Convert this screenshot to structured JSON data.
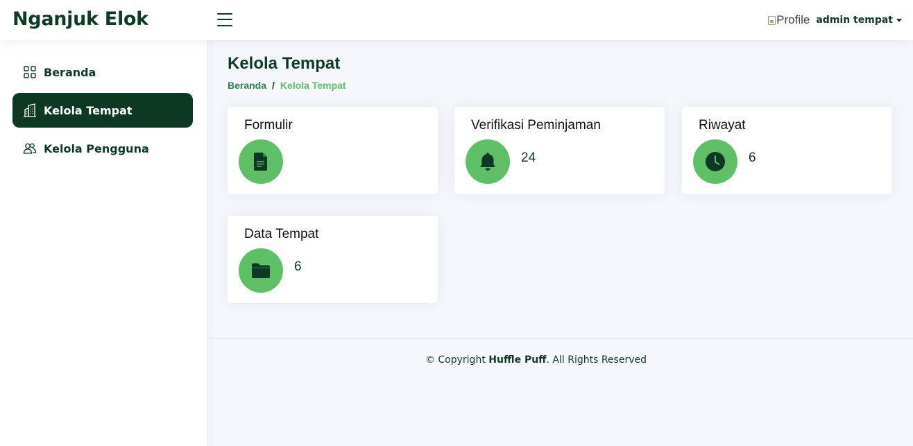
{
  "header": {
    "brand": "Nganjuk Elok",
    "profile_img_alt": "Profile",
    "user_name": "admin tempat"
  },
  "sidebar": {
    "items": [
      {
        "label": "Beranda",
        "icon": "grid-icon",
        "active": false
      },
      {
        "label": "Kelola Tempat",
        "icon": "building-icon",
        "active": true
      },
      {
        "label": "Kelola Pengguna",
        "icon": "people-icon",
        "active": false
      }
    ]
  },
  "main": {
    "title": "Kelola Tempat",
    "breadcrumb": {
      "home": "Beranda",
      "separator": "/",
      "current": "Kelola Tempat"
    },
    "cards": [
      {
        "title": "Formulir",
        "icon": "document-icon",
        "count": ""
      },
      {
        "title": "Verifikasi Peminjaman",
        "icon": "bell-icon",
        "count": "24"
      },
      {
        "title": "Riwayat",
        "icon": "clock-icon",
        "count": "6"
      },
      {
        "title": "Data Tempat",
        "icon": "folder-icon",
        "count": "6"
      }
    ]
  },
  "footer": {
    "prefix": "© Copyright ",
    "brand": "Huffle Puff",
    "suffix": ". All Rights Reserved"
  },
  "colors": {
    "primary_dark": "#0d3924",
    "accent_green": "#5fbf66",
    "background": "#f5f7fc"
  }
}
